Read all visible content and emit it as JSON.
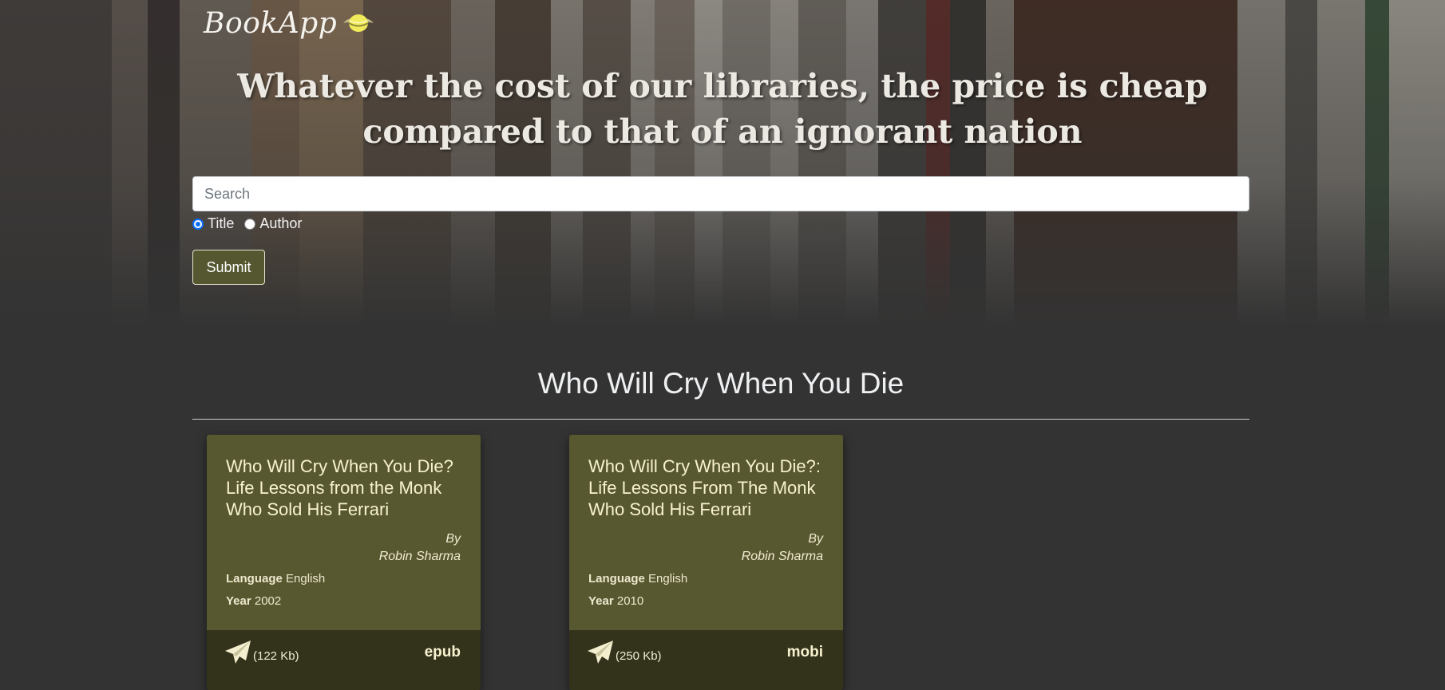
{
  "header": {
    "logo_text": "BookApp",
    "quote": "Whatever the cost of our libraries, the price is cheap compared to that of an ignorant nation"
  },
  "search": {
    "placeholder": "Search",
    "value": "",
    "options": [
      {
        "label": "Title",
        "checked": true
      },
      {
        "label": "Author",
        "checked": false
      }
    ],
    "submit_label": "Submit"
  },
  "results": {
    "heading": "Who Will Cry When You Die",
    "books": [
      {
        "title": "Who Will Cry When You Die? Life Lessons from the Monk Who Sold His Ferrari",
        "by_label": "By",
        "author": "Robin Sharma",
        "language_label": "Language",
        "language": "English",
        "year_label": "Year",
        "year": "2002",
        "size": "(122 Kb)",
        "format": "epub"
      },
      {
        "title": "Who Will Cry When You Die?: Life Lessons From The Monk Who Sold His Ferrari",
        "by_label": "By",
        "author": "Robin Sharma",
        "language_label": "Language",
        "language": "English",
        "year_label": "Year",
        "year": "2010",
        "size": "(250 Kb)",
        "format": "mobi"
      }
    ]
  },
  "icons": {
    "logo": "book-wings-icon",
    "download": "paper-plane-icon"
  },
  "colors": {
    "page_bg": "#333333",
    "card_bg": "#585830",
    "card_footer_bg": "#33331c",
    "card_text": "#f7f1cf",
    "submit_bg": "#545730",
    "radio_accent": "#0d6efd"
  }
}
